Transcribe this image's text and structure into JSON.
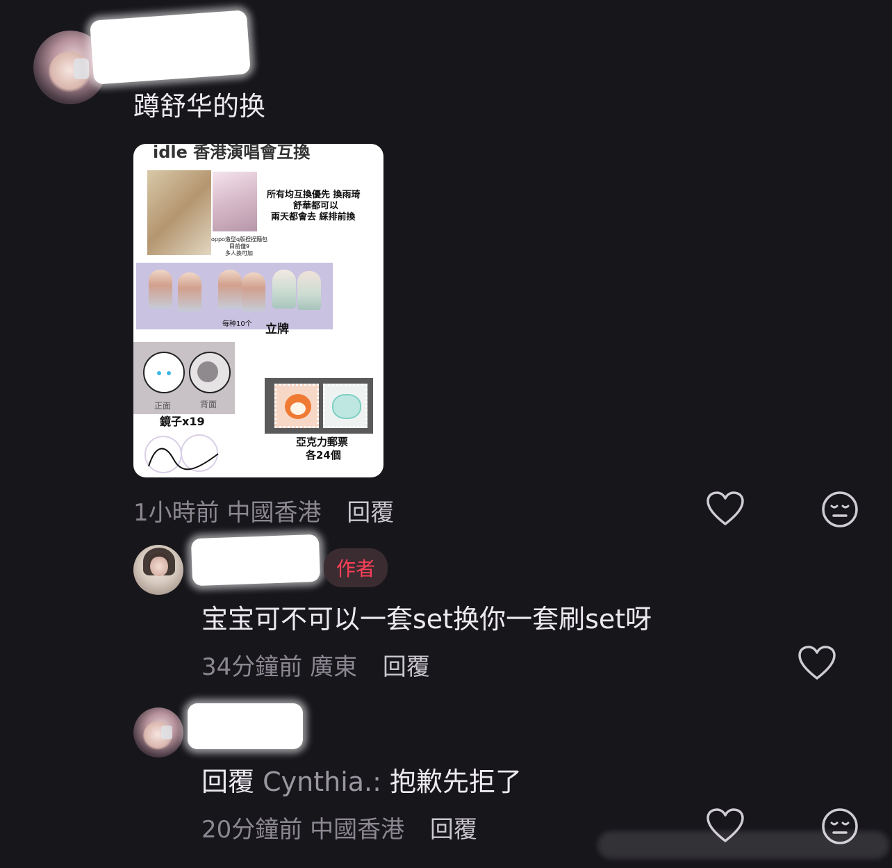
{
  "comments": [
    {
      "text": "蹲舒华的换",
      "time": "1小時前",
      "location": "中國香港",
      "reply_label": "回覆",
      "actions": [
        "heart-icon",
        "meh-face-icon"
      ]
    },
    {
      "badge": "作者",
      "text": "宝宝可不可以一套set换你一套刷set呀",
      "time": "34分鐘前",
      "location": "廣東",
      "reply_label": "回覆",
      "actions": [
        "heart-icon"
      ]
    },
    {
      "reply_prefix": "回覆",
      "reply_to": "Cynthia.:",
      "text": "抱歉先拒了",
      "time": "20分鐘前",
      "location": "中國香港",
      "reply_label": "回覆",
      "actions": [
        "heart-icon",
        "meh-face-icon"
      ]
    }
  ],
  "attachment": {
    "title": "idle 香港演唱會互換",
    "note_line1": "所有均互換優先 換雨琦",
    "note_line2": "舒華都可以",
    "note_line3": "兩天都會去 綵排前換",
    "bread_caption1": "oppo造型q版捏捏麵包",
    "bread_caption2": "目前僅9",
    "bread_caption3": "多人換可加",
    "standee_count": "每种10个",
    "standee_label": "立牌",
    "mirror_front": "正面",
    "mirror_back": "背面",
    "mirror_label": "鏡子x19",
    "stamp_label": "亞克力郵票",
    "stamp_count": "各24個"
  },
  "colors": {
    "background": "#17161b",
    "author_badge_text": "#ff3f58",
    "meta_text": "#8c8891"
  }
}
